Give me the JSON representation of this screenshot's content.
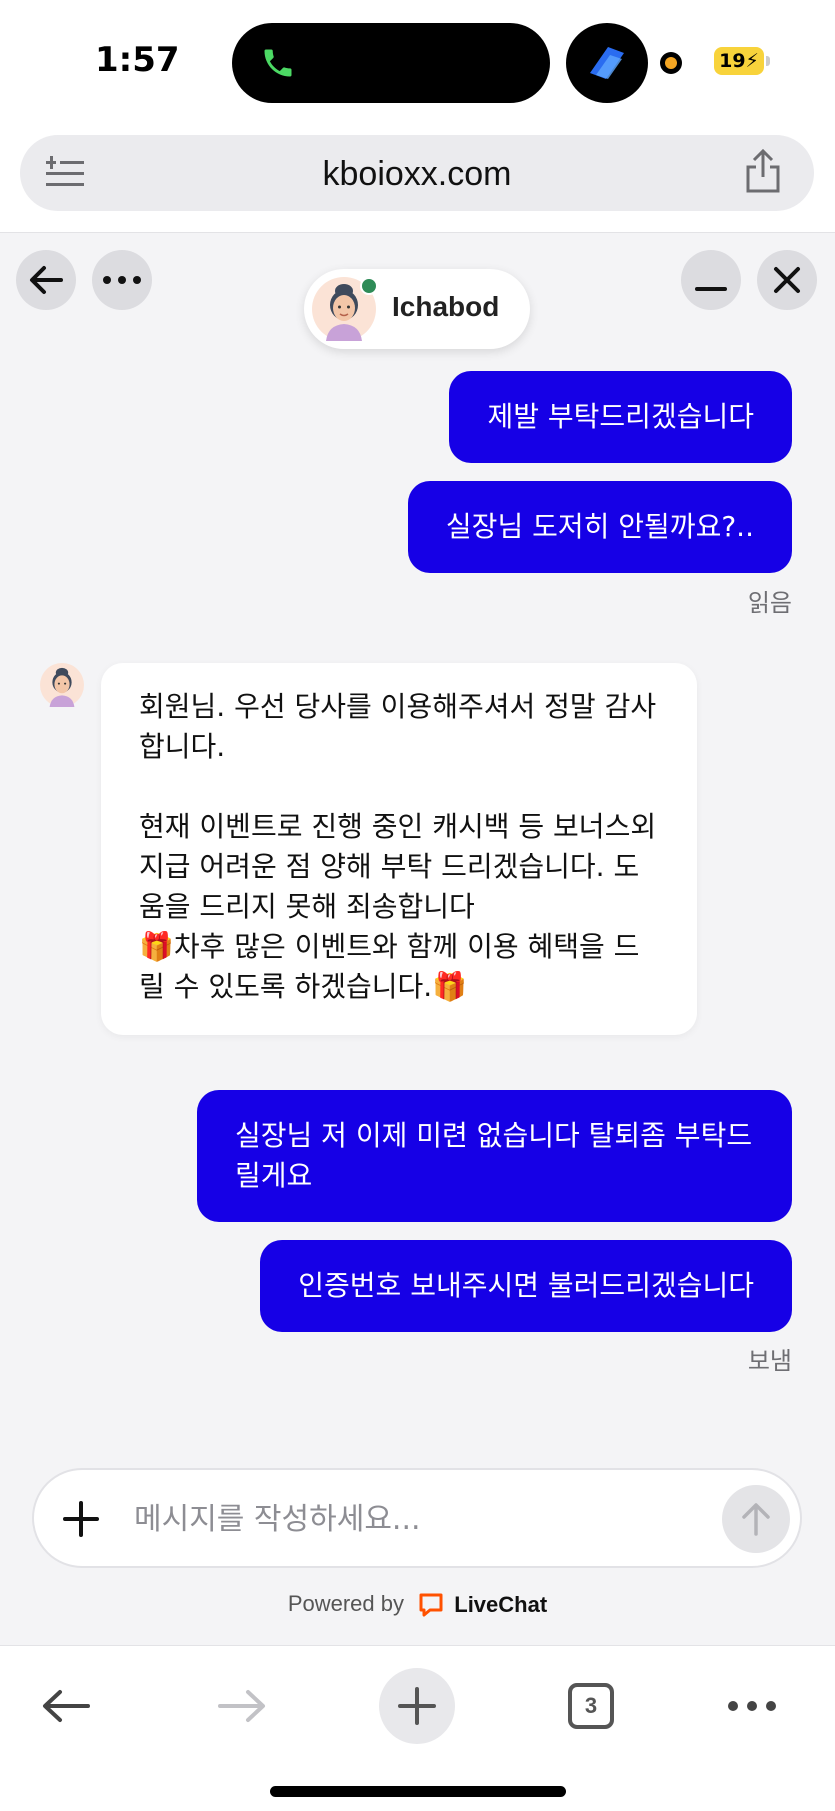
{
  "status": {
    "time": "1:57",
    "battery": "19"
  },
  "browser": {
    "url": "kboioxx.com",
    "open_tabs": "3"
  },
  "chat": {
    "agent_name": "Ichabod",
    "messages": [
      {
        "from": "visitor",
        "text": "제발 부탁드리겠습니다"
      },
      {
        "from": "visitor",
        "text": "실장님 도저히 안될까요?.."
      },
      {
        "from": "agent",
        "text": "회원님. 우선 당사를 이용해주셔서 정말 감사합니다.\n\n현재 이벤트로 진행 중인 캐시백 등 보너스외 지급 어려운 점 양해 부탁 드리겠습니다. 도움을 드리지 못해 죄송합니다\n🎁차후 많은 이벤트와 함께 이용 혜택을 드릴 수 있도록 하겠습니다.🎁"
      },
      {
        "from": "visitor",
        "text": "실장님 저 이제 미련 없습니다 탈퇴좀 부탁드릴게요"
      },
      {
        "from": "visitor",
        "text": "인증번호 보내주시면 불러드리겠습니다"
      }
    ],
    "receipt_read": "읽음",
    "receipt_sent": "보냄",
    "composer_placeholder": "메시지를 작성하세요...",
    "powered_by": "Powered by",
    "brand": "LiveChat"
  },
  "colors": {
    "outgoing_bubble": "#1600e6",
    "chat_background": "#f4f4f6",
    "online_dot": "#2e8b57",
    "livechat_brand": "#ff5100"
  },
  "icons": {
    "back": "arrow-left-icon",
    "more": "ellipsis-icon",
    "minimize": "minus-icon",
    "close": "close-icon",
    "attach": "plus-icon",
    "send": "arrow-up-icon"
  }
}
